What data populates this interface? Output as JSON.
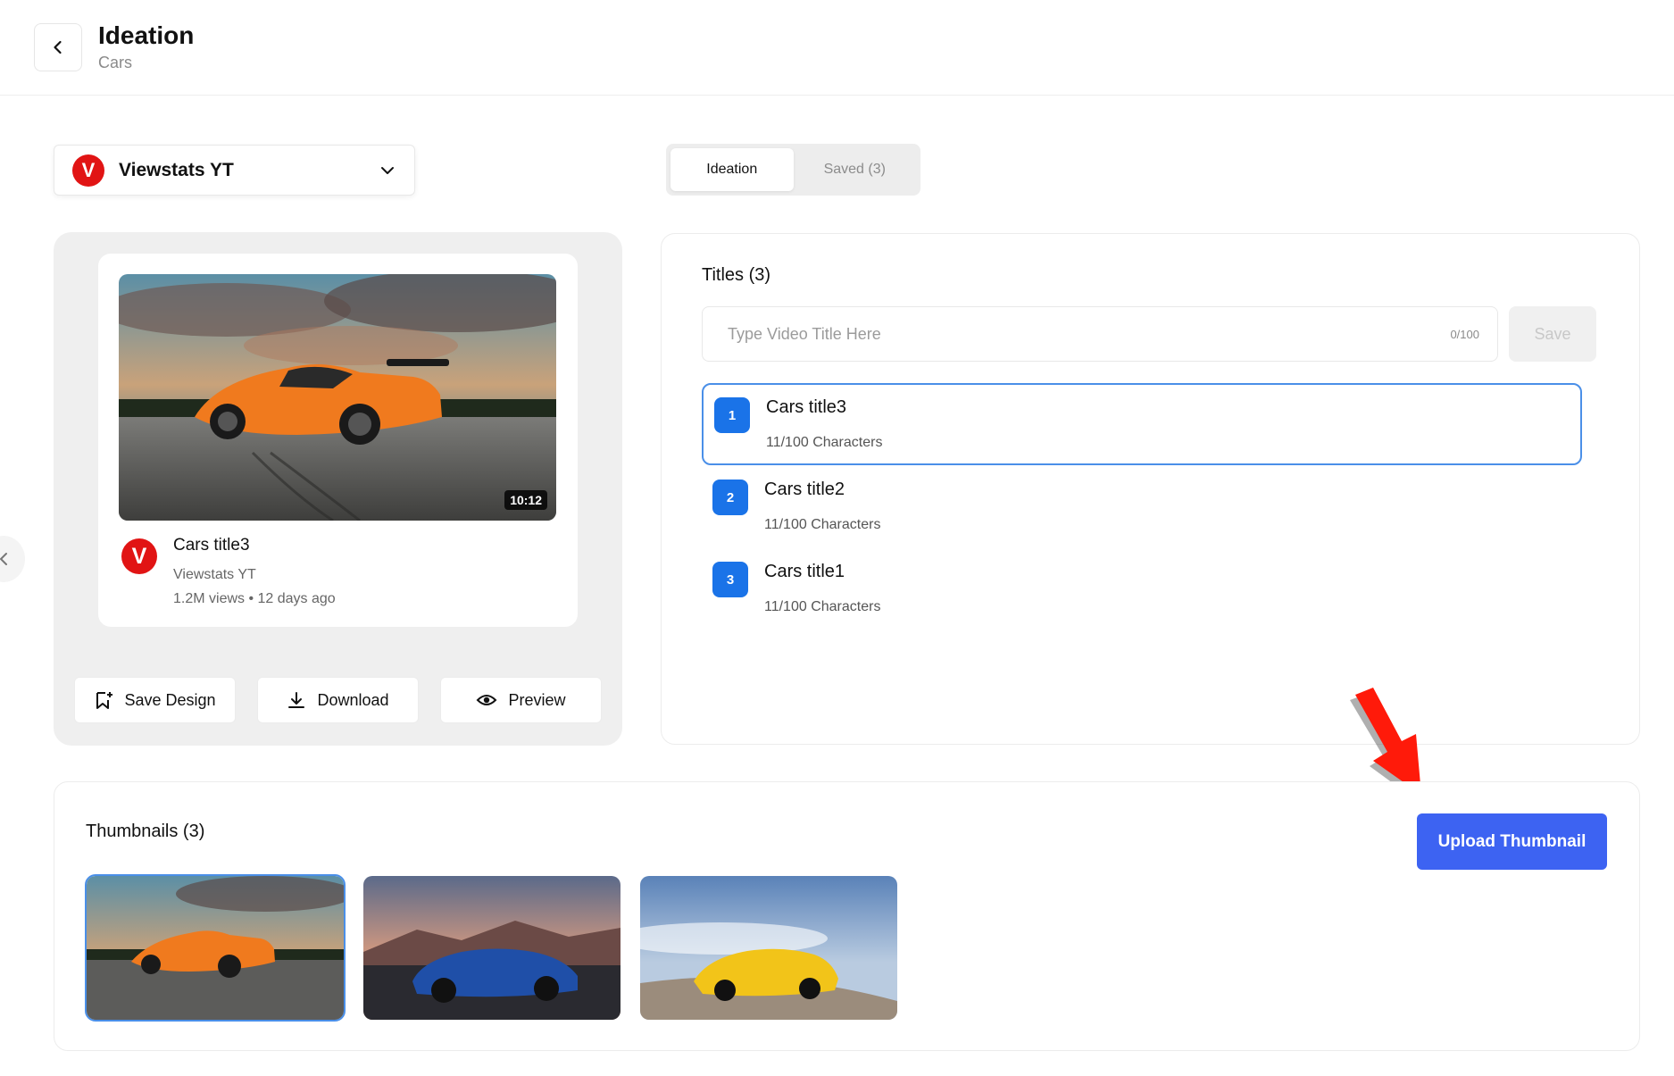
{
  "header": {
    "title": "Ideation",
    "subtitle": "Cars"
  },
  "channel_select": {
    "logo_letter": "V",
    "name": "Viewstats YT"
  },
  "tabs": [
    {
      "label": "Ideation",
      "active": true
    },
    {
      "label": "Saved (3)",
      "active": false
    }
  ],
  "preview": {
    "duration": "10:12",
    "logo_letter": "V",
    "title": "Cars title3",
    "channel": "Viewstats YT",
    "meta": "1.2M views • 12 days ago"
  },
  "actions": {
    "save_design": "Save Design",
    "download": "Download",
    "preview": "Preview"
  },
  "titles": {
    "heading": "Titles (3)",
    "input_placeholder": "Type Video Title Here",
    "input_value": "",
    "char_count": "0/100",
    "save_label": "Save",
    "items": [
      {
        "number": "1",
        "title": "Cars title3",
        "chars": "11/100 Characters",
        "selected": true
      },
      {
        "number": "2",
        "title": "Cars title2",
        "chars": "11/100 Characters",
        "selected": false
      },
      {
        "number": "3",
        "title": "Cars title1",
        "chars": "11/100 Characters",
        "selected": false
      }
    ]
  },
  "thumbnails": {
    "heading": "Thumbnails (3)",
    "upload_label": "Upload Thumbnail",
    "items": [
      {
        "car_color": "#f07a1e",
        "selected": true
      },
      {
        "car_color": "#1f4fa8",
        "selected": false
      },
      {
        "car_color": "#f2c419",
        "selected": false
      }
    ]
  },
  "colors": {
    "accent_blue": "#1a73e8",
    "upload_blue": "#3d63f2",
    "brand_red": "#e11414",
    "arrow_red": "#ff1a0a"
  },
  "icons": {
    "back": "chevron-left-icon",
    "dropdown": "chevron-down-icon",
    "save_design": "bookmark-plus-icon",
    "download": "download-icon",
    "preview": "eye-icon",
    "side": "chevron-left-icon"
  }
}
